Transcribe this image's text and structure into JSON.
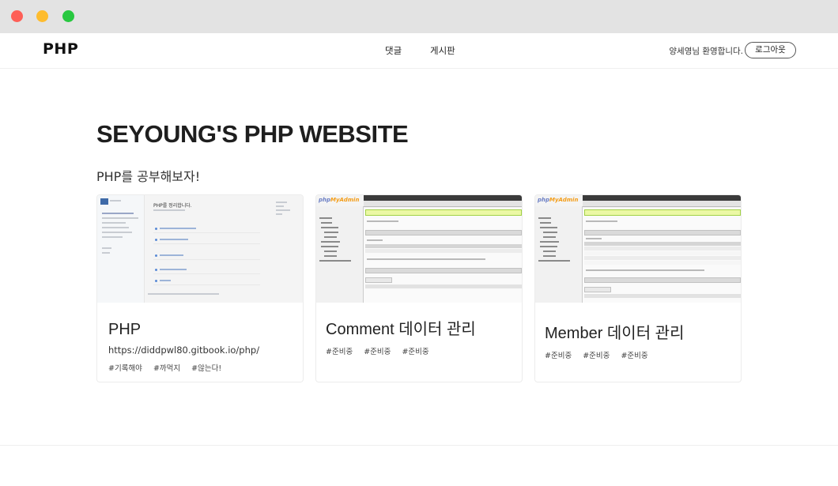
{
  "window": {
    "controls": [
      "close",
      "minimize",
      "maximize"
    ]
  },
  "navbar": {
    "brand": "PHP",
    "links": [
      {
        "label": "댓글"
      },
      {
        "label": "게시판"
      }
    ],
    "welcome": "양세영님 환영합니다.",
    "logout_label": "로그아웃"
  },
  "hero": {
    "title": "SEYOUNG'S PHP WEBSITE",
    "subtitle": "PHP를 공부해보자!"
  },
  "cards": [
    {
      "title": "PHP",
      "url": "https://diddpwl80.gitbook.io/php/",
      "tags": [
        "#기록해야",
        "#까먹지",
        "#않는다!"
      ],
      "thumbnail": "gitbook-screenshot",
      "thumb_title": "PHP를 정리합니다."
    },
    {
      "title": "Comment 데이터 관리",
      "tags": [
        "#준비중",
        "#준비중",
        "#준비중"
      ],
      "thumbnail": "phpmyadmin-screenshot"
    },
    {
      "title": "Member 데이터 관리",
      "tags": [
        "#준비중",
        "#준비중",
        "#준비중"
      ],
      "thumbnail": "phpmyadmin-screenshot"
    }
  ],
  "colors": {
    "chrome_bg": "#e3e3e3",
    "close": "#fe5f57",
    "minimize": "#febc2e",
    "maximize": "#28c840",
    "text": "#222222",
    "card_border": "#ececec"
  }
}
